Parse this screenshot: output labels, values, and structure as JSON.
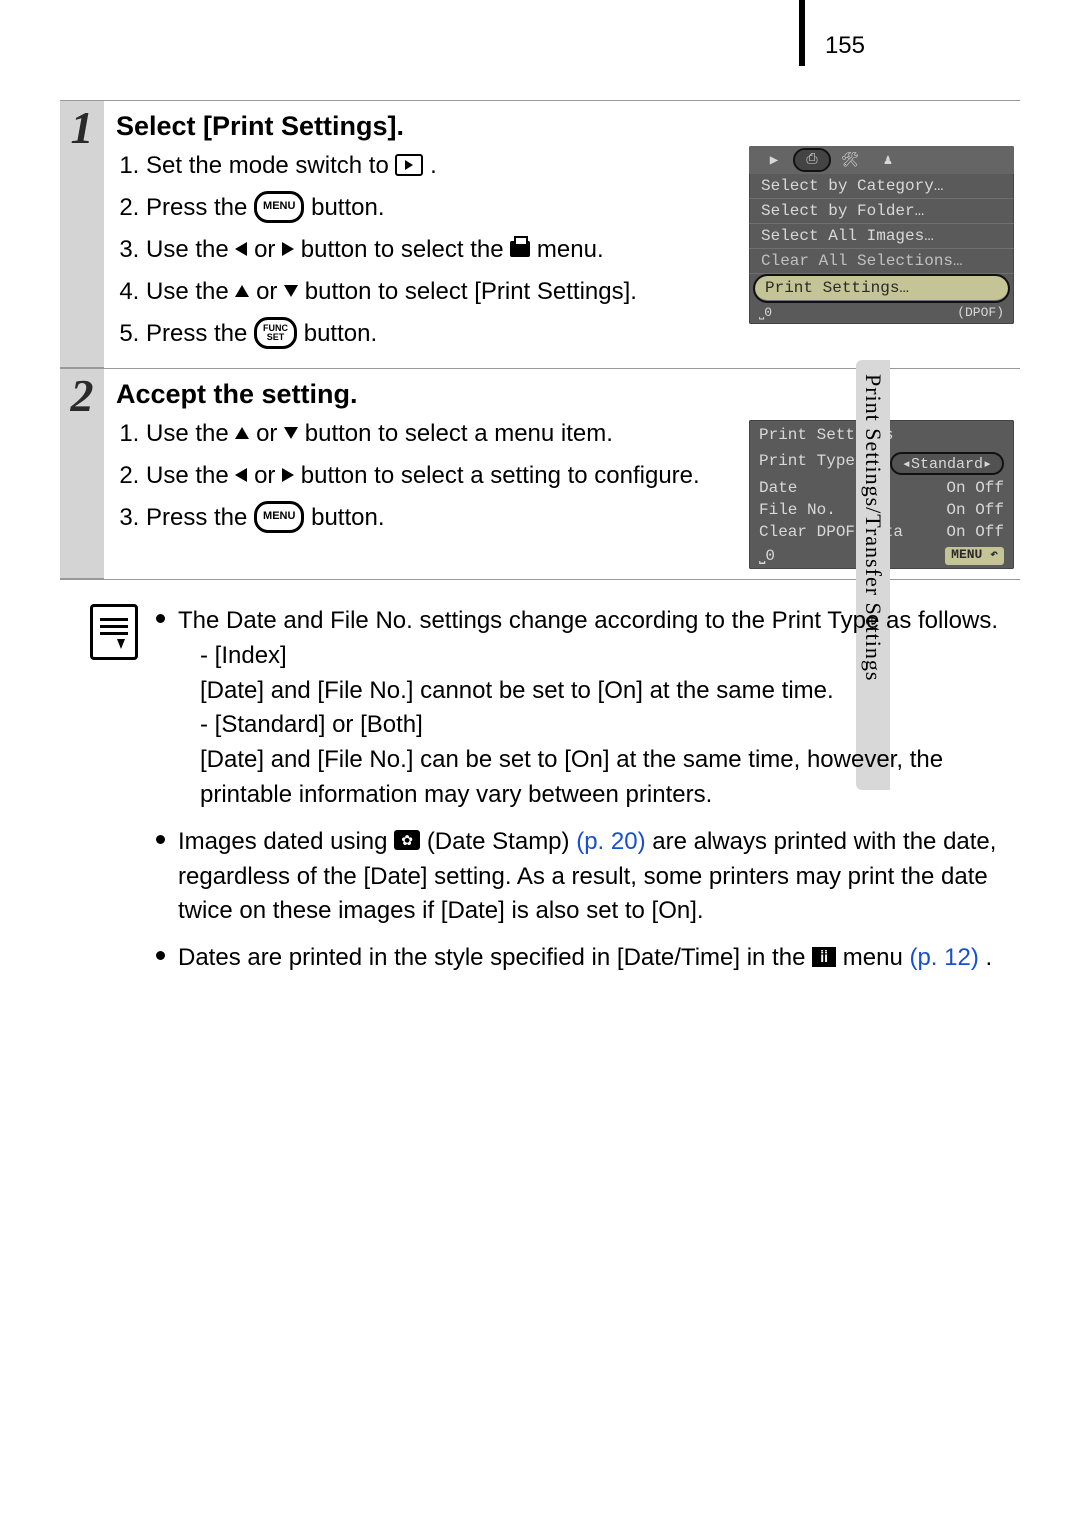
{
  "page": {
    "number": "155",
    "side_tab": "Print Settings/Transfer Settings"
  },
  "step1": {
    "num": "1",
    "title": "Select [Print Settings].",
    "sub1_a": "Set the mode switch to ",
    "sub1_b": ".",
    "sub2_a": "Press the ",
    "sub2_b": " button.",
    "menu_label": "MENU",
    "sub3_a": "Use the ",
    "sub3_or": " or ",
    "sub3_b": " button to select the ",
    "sub3_c": " menu.",
    "sub4_a": "Use the ",
    "sub4_or": " or ",
    "sub4_b": " button to select [Print Settings].",
    "sub5_a": "Press the ",
    "sub5_b": " button.",
    "func_top": "FUNC",
    "func_bot": "SET",
    "lcd": {
      "t_play": "▶",
      "t_print": "⎙",
      "t_tools": "🛠",
      "t_person": "♟",
      "r1": "Select by Category…",
      "r2": "Select by Folder…",
      "r3": "Select All Images…",
      "r4": "Clear All Selections…",
      "r5": "Print Settings…",
      "foot_l": "⎵0",
      "foot_r": "(DPOF)"
    }
  },
  "step2": {
    "num": "2",
    "title": "Accept the setting.",
    "sub1_a": "Use the ",
    "sub1_or": " or ",
    "sub1_b": " button to select a menu item.",
    "sub2_a": "Use the ",
    "sub2_or": " or ",
    "sub2_b": " button to select a setting to configure.",
    "sub3_a": "Press the ",
    "sub3_b": " button.",
    "menu_label": "MENU",
    "lcd": {
      "hdr": "Print Settings",
      "o1l": "Print Type",
      "o1r": "◂Standard▸",
      "o2l": "Date",
      "o2r": "On Off",
      "o3l": "File No.",
      "o3r": "On Off",
      "o4l": "Clear DPOF data",
      "o4r": "On Off",
      "foot_l": "⎵0",
      "menu_btn": "MENU ↶"
    }
  },
  "notes": {
    "b1_a": "The Date and File No. settings change according to the Print Type as follows.",
    "b1_idx_t": "- [Index]",
    "b1_idx_d": "[Date] and [File No.] cannot be set to [On] at the same time.",
    "b1_std_t": "- [Standard] or [Both]",
    "b1_std_d": "[Date] and [File No.] can be set to [On] at the same time, however, the printable information may vary between printers.",
    "b2_a": "Images dated using ",
    "b2_b": " (Date Stamp) ",
    "b2_link": "(p. 20)",
    "b2_c": " are always printed with the date, regardless of the [Date] setting. As a result, some printers may print the date twice on these images if [Date] is also set to [On].",
    "b3_a": "Dates are printed in the style specified in [Date/Time] in the ",
    "b3_b": " menu ",
    "b3_link": "(p. 12)",
    "b3_c": "."
  }
}
